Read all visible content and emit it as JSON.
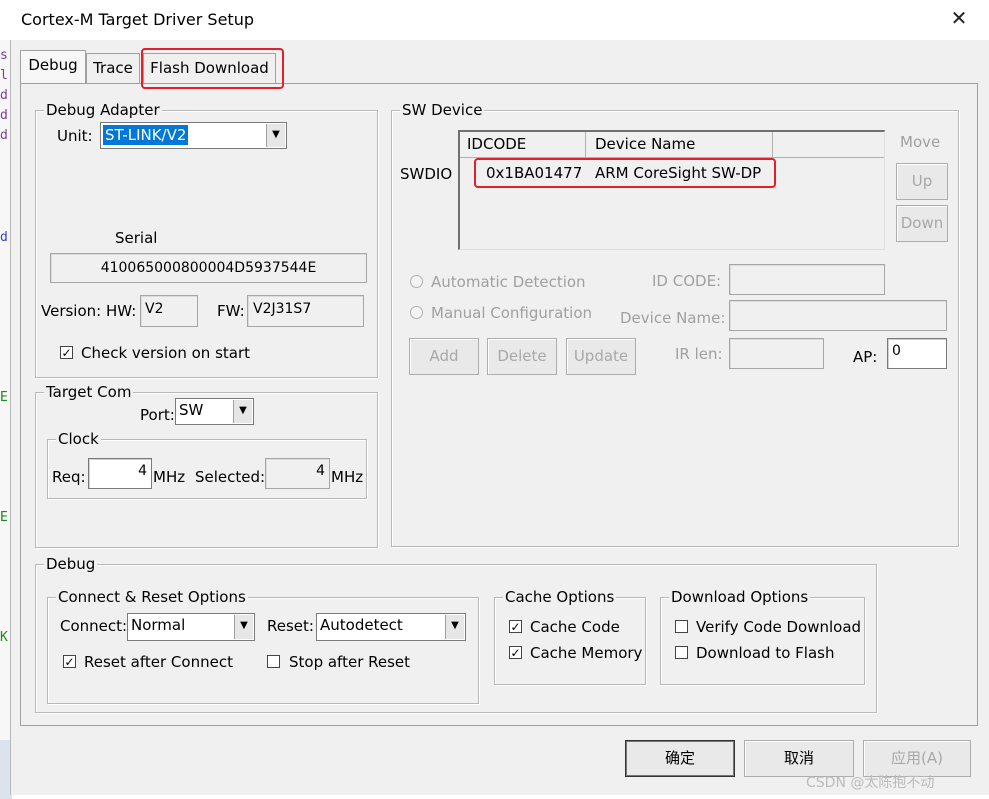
{
  "window": {
    "title": "Cortex-M Target Driver Setup",
    "close": "✕"
  },
  "tabs": [
    "Debug",
    "Trace",
    "Flash Download"
  ],
  "debug_adapter": {
    "legend": "Debug Adapter",
    "unit_label": "Unit:",
    "unit_value": "ST-LINK/V2",
    "serial_label": "Serial",
    "serial_value": "410065000800004D5937544E",
    "version_label": "Version: HW:",
    "hw_value": "V2",
    "fw_label": "FW:",
    "fw_value": "V2J31S7",
    "check_version_label": "Check version on start",
    "check_version_checked": true
  },
  "target_com": {
    "legend": "Target Com",
    "port_label": "Port:",
    "port_value": "SW",
    "clock": {
      "legend": "Clock",
      "req_label": "Req:",
      "req_value": "4",
      "mhz1": "MHz",
      "selected_label": "Selected:",
      "selected_value": "4",
      "mhz2": "MHz"
    }
  },
  "sw_device": {
    "legend": "SW Device",
    "swdio_label": "SWDIO",
    "columns": [
      "IDCODE",
      "Device Name"
    ],
    "rows": [
      {
        "idcode": "0x1BA01477",
        "name": "ARM CoreSight SW-DP"
      }
    ],
    "move_label": "Move",
    "up_label": "Up",
    "down_label": "Down",
    "auto_detect_label": "Automatic Detection",
    "manual_config_label": "Manual Configuration",
    "id_code_label": "ID CODE:",
    "device_name_label": "Device Name:",
    "add_label": "Add",
    "delete_label": "Delete",
    "update_label": "Update",
    "ir_len_label": "IR len:",
    "ap_label": "AP:",
    "ap_value": "0"
  },
  "debug": {
    "legend": "Debug",
    "connect_reset": {
      "legend": "Connect & Reset Options",
      "connect_label": "Connect:",
      "connect_value": "Normal",
      "reset_label": "Reset:",
      "reset_value": "Autodetect",
      "reset_after_connect_label": "Reset after Connect",
      "reset_after_connect_checked": true,
      "stop_after_reset_label": "Stop after Reset",
      "stop_after_reset_checked": false
    },
    "cache": {
      "legend": "Cache Options",
      "cache_code_label": "Cache Code",
      "cache_code_checked": true,
      "cache_memory_label": "Cache Memory",
      "cache_memory_checked": true
    },
    "download": {
      "legend": "Download Options",
      "verify_label": "Verify Code Download",
      "verify_checked": false,
      "download_flash_label": "Download to Flash",
      "download_flash_checked": false
    }
  },
  "footer": {
    "ok_label": "确定",
    "cancel_label": "取消",
    "apply_label": "应用(A)"
  },
  "watermark": "CSDN @太陈抱不动",
  "colors": {
    "highlight_red": "#e0202a",
    "selection_blue": "#0078d7",
    "dialog_bg": "#f0f0f0"
  }
}
